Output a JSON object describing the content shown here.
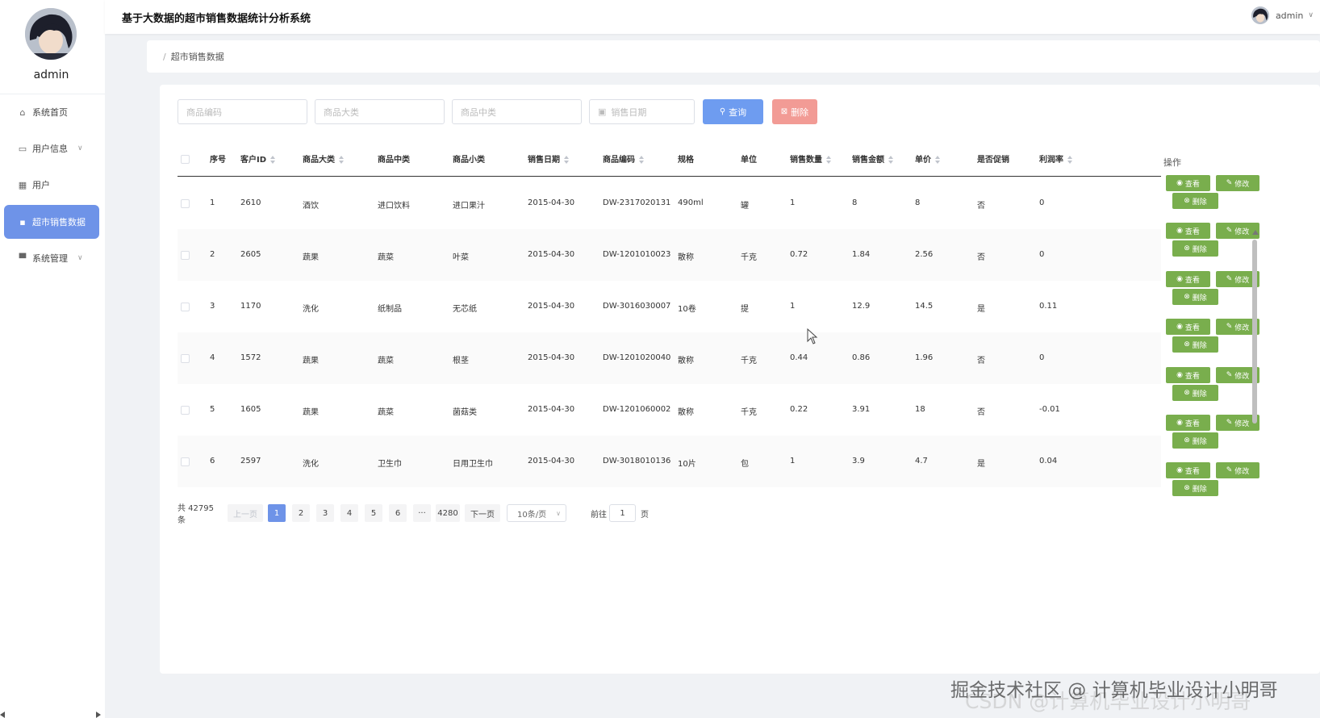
{
  "app": {
    "title": "基于大数据的超市销售数据统计分析系统"
  },
  "user": {
    "name": "admin"
  },
  "sidebar": {
    "items": [
      {
        "label": "系统首页",
        "icon": "home-icon"
      },
      {
        "label": "用户信息",
        "icon": "idcard-icon",
        "expandable": true
      },
      {
        "label": "用户",
        "icon": "grid-icon"
      },
      {
        "label": "超市销售数据",
        "icon": "chat-icon",
        "active": true
      },
      {
        "label": "系统管理",
        "icon": "monitor-icon",
        "expandable": true
      }
    ]
  },
  "breadcrumb": {
    "separator": "/",
    "current": "超市销售数据"
  },
  "search": {
    "product_code_placeholder": "商品编码",
    "category_placeholder": "商品大类",
    "mid_category_placeholder": "商品中类",
    "sale_date_placeholder": "销售日期",
    "query_label": "查询",
    "delete_label": "删除"
  },
  "table": {
    "columns": [
      "序号",
      "客户ID",
      "商品大类",
      "商品中类",
      "商品小类",
      "销售日期",
      "商品编码",
      "规格",
      "单位",
      "销售数量",
      "销售金额",
      "单价",
      "是否促销",
      "利润率"
    ],
    "operation_header": "操作",
    "rows": [
      [
        "1",
        "2610",
        "酒饮",
        "进口饮料",
        "进口果汁",
        "2015-04-30",
        "DW-2317020131",
        "490ml",
        "罐",
        "1",
        "8",
        "8",
        "否",
        "0"
      ],
      [
        "2",
        "2605",
        "蔬果",
        "蔬菜",
        "叶菜",
        "2015-04-30",
        "DW-1201010023",
        "散称",
        "千克",
        "0.72",
        "1.84",
        "2.56",
        "否",
        "0"
      ],
      [
        "3",
        "1170",
        "洗化",
        "纸制品",
        "无芯纸",
        "2015-04-30",
        "DW-3016030007",
        "10卷",
        "提",
        "1",
        "12.9",
        "14.5",
        "是",
        "0.11"
      ],
      [
        "4",
        "1572",
        "蔬果",
        "蔬菜",
        "根茎",
        "2015-04-30",
        "DW-1201020040",
        "散称",
        "千克",
        "0.44",
        "0.86",
        "1.96",
        "否",
        "0"
      ],
      [
        "5",
        "1605",
        "蔬果",
        "蔬菜",
        "菌菇类",
        "2015-04-30",
        "DW-1201060002",
        "散称",
        "千克",
        "0.22",
        "3.91",
        "18",
        "否",
        "-0.01"
      ],
      [
        "6",
        "2597",
        "洗化",
        "卫生巾",
        "日用卫生巾",
        "2015-04-30",
        "DW-3018010136",
        "10片",
        "包",
        "1",
        "3.9",
        "4.7",
        "是",
        "0.04"
      ]
    ],
    "row_actions": {
      "view": "查看",
      "edit": "修改",
      "delete": "删除"
    }
  },
  "pagination": {
    "total": "共 42795 条",
    "prev": "上一页",
    "pages": [
      "1",
      "2",
      "3",
      "4",
      "5",
      "6"
    ],
    "ellipsis": "···",
    "last_page": "4280",
    "next": "下一页",
    "page_size": "10条/页",
    "goto_label": "前往",
    "goto_value": "1",
    "page_suffix": "页",
    "current": 1
  },
  "watermark": {
    "line1": "掘金技术社区 @ 计算机毕业设计小明哥",
    "line2": "CSDN @计算机毕业设计小明哥"
  },
  "colors": {
    "accent": "#6e93e8",
    "query_button": "#6e9cf0",
    "delete_button": "#f29b95",
    "action_button": "#79ae4d"
  }
}
